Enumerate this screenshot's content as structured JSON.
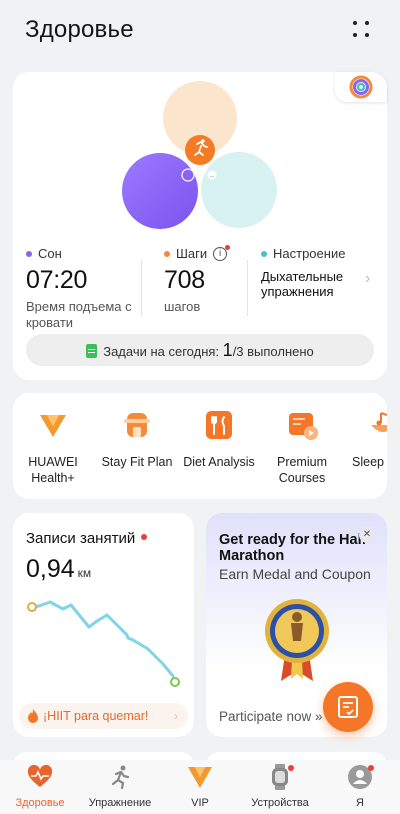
{
  "header": {
    "title": "Здоровье",
    "menu_icon": "more-grid-icon"
  },
  "summary": {
    "metrics": [
      {
        "label": "Сон",
        "dot_color": "#8a64ee",
        "value": "07:20",
        "sub": "Время подъема с кровати"
      },
      {
        "label": "Шаги",
        "dot_color": "#f28a3a",
        "value": "708",
        "sub": "шагов"
      },
      {
        "label": "Настроение",
        "dot_color": "#4bc1c3",
        "text": "Дыхательные упражнения"
      }
    ],
    "tasks": {
      "prefix": "Задачи на сегодня:",
      "done": "1",
      "suffix": "/3 выполнено"
    }
  },
  "shortcuts": [
    {
      "label": "HUAWEI Health+",
      "icon": "vip-icon"
    },
    {
      "label": "Stay Fit Plan",
      "icon": "body-fit-icon"
    },
    {
      "label": "Diet Analysis",
      "icon": "diet-icon"
    },
    {
      "label": "Premium Courses",
      "icon": "courses-icon"
    },
    {
      "label": "Sleep I",
      "icon": "sleep-music-icon"
    }
  ],
  "records": {
    "title": "Записи занятий",
    "value": "0,94",
    "unit": "км",
    "promo": "¡HIIT para quemar!"
  },
  "promo": {
    "title": "Get ready for the Half Marathon",
    "subtitle": "Earn Medal and Coupon",
    "cta": "Participate now »"
  },
  "tabs": [
    {
      "label": "Здоровье",
      "icon": "heart-pulse-icon",
      "active": true
    },
    {
      "label": "Упражнение",
      "icon": "running-icon"
    },
    {
      "label": "VIP",
      "icon": "vip-icon"
    },
    {
      "label": "Устройства",
      "icon": "watch-icon",
      "badge": true
    },
    {
      "label": "Я",
      "icon": "profile-icon",
      "badge": true
    }
  ],
  "colors": {
    "accent": "#e9632d",
    "sleep": "#8a64ee",
    "steps": "#f28a3a",
    "mood": "#4bc1c3",
    "route": "#7fd4e8"
  }
}
